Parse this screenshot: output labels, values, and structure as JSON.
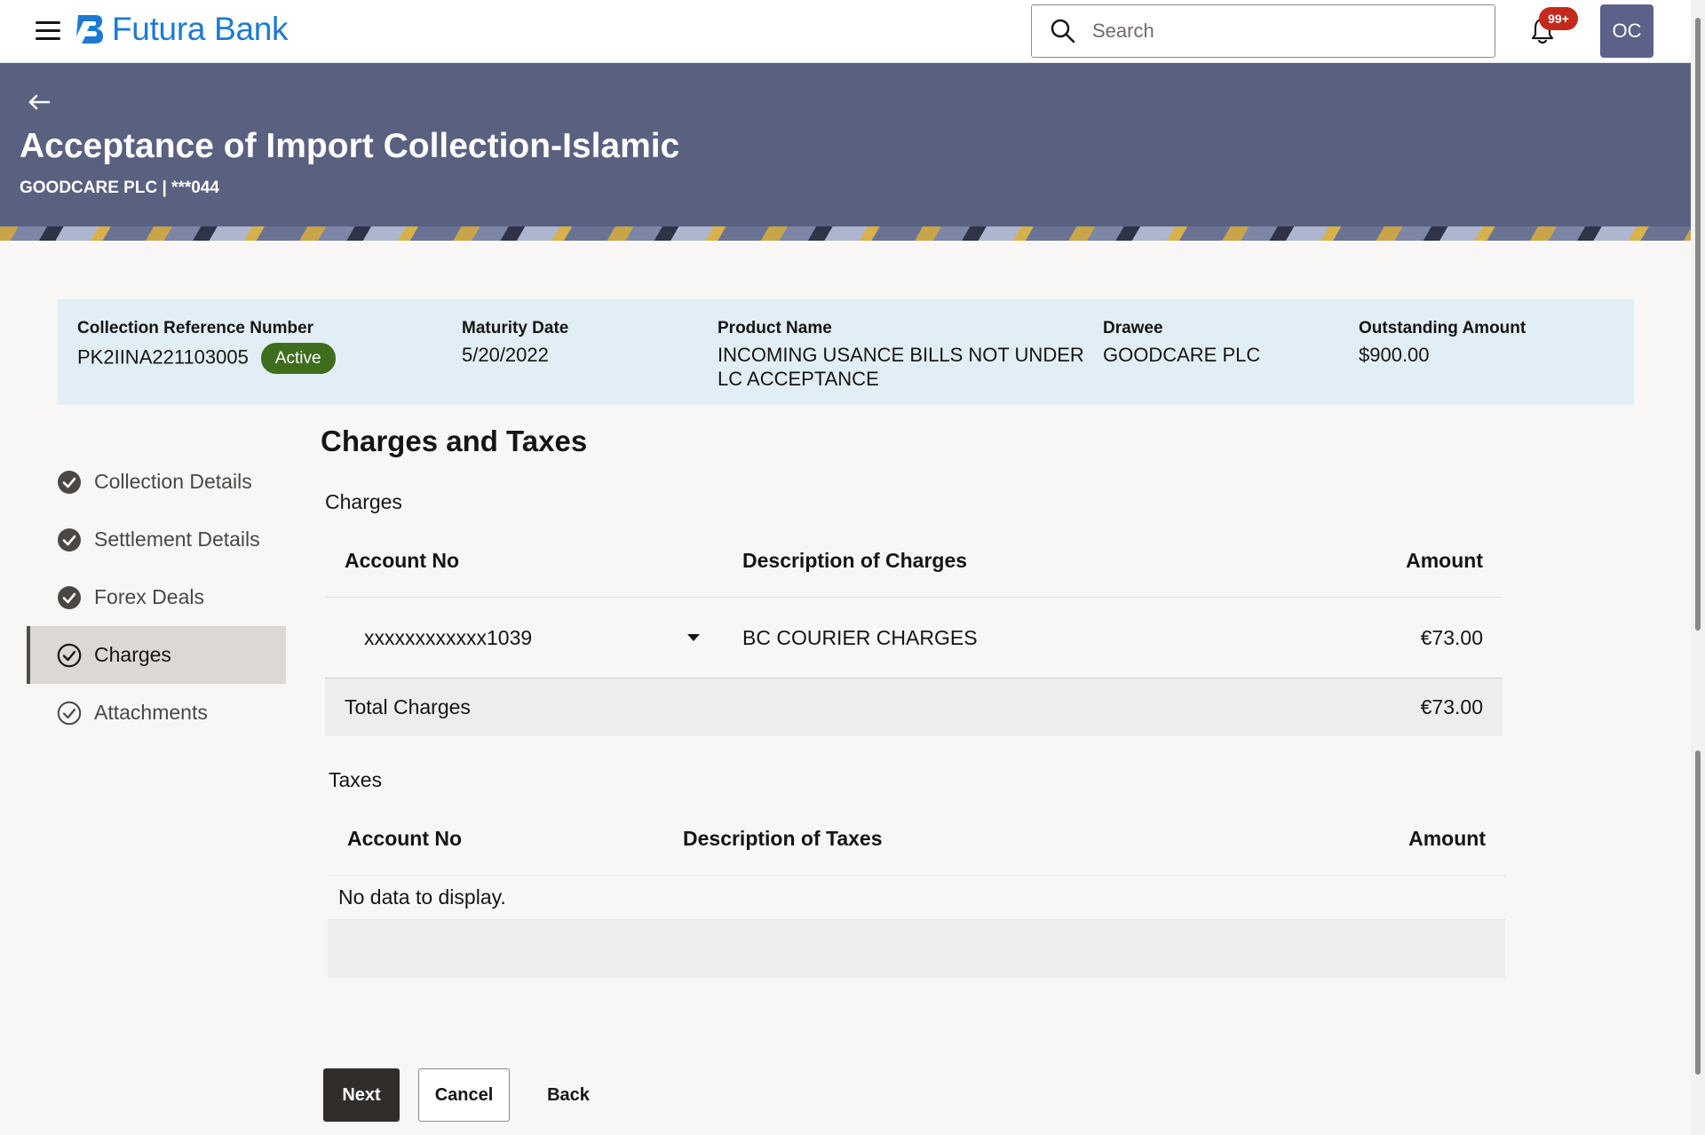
{
  "brand": {
    "name": "Futura Bank",
    "color": "#1c7ad3"
  },
  "header": {
    "search_placeholder": "Search",
    "notification_count": "99+",
    "user_initials": "OC"
  },
  "page": {
    "title": "Acceptance of Import Collection-Islamic",
    "subtitle": "GOODCARE PLC | ***044"
  },
  "summary": {
    "ref_label": "Collection Reference Number",
    "ref_value": "PK2IINA221103005",
    "status": "Active",
    "maturity_label": "Maturity Date",
    "maturity_value": "5/20/2022",
    "product_label": "Product Name",
    "product_value": "INCOMING USANCE BILLS NOT UNDER LC ACCEPTANCE",
    "drawee_label": "Drawee",
    "drawee_value": "GOODCARE PLC",
    "outstanding_label": "Outstanding Amount",
    "outstanding_value": "$900.00"
  },
  "nav": {
    "items": [
      {
        "label": "Collection Details",
        "state": "complete"
      },
      {
        "label": "Settlement Details",
        "state": "complete"
      },
      {
        "label": "Forex Deals",
        "state": "complete"
      },
      {
        "label": "Charges",
        "state": "active"
      },
      {
        "label": "Attachments",
        "state": "pending"
      }
    ]
  },
  "main": {
    "section_title": "Charges and Taxes",
    "charges": {
      "heading": "Charges",
      "columns": [
        "Account No",
        "Description of Charges",
        "Amount"
      ],
      "rows": [
        {
          "account": "xxxxxxxxxxxx1039",
          "description": "BC COURIER CHARGES",
          "amount": "€73.00"
        }
      ],
      "total_label": "Total Charges",
      "total_value": "€73.00"
    },
    "taxes": {
      "heading": "Taxes",
      "columns": [
        "Account No",
        "Description of Taxes",
        "Amount"
      ],
      "empty_message": "No data to display."
    }
  },
  "actions": {
    "next": "Next",
    "cancel": "Cancel",
    "back": "Back"
  },
  "colors": {
    "hero_bg": "#5a607f",
    "status_active": "#3e6d1e",
    "primary_button": "#312d2a",
    "summary_bg": "#e2eef5",
    "badge": "#c5281c"
  }
}
